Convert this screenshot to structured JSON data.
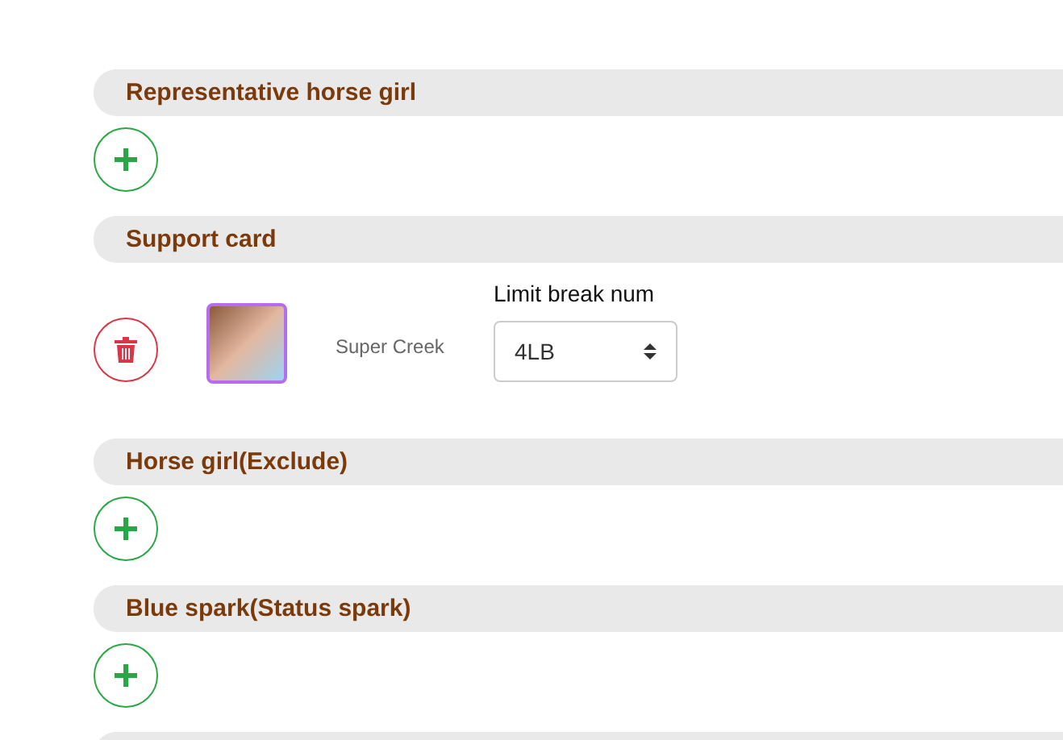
{
  "sections": [
    {
      "title": "Representative horse girl",
      "kind": "add"
    },
    {
      "title": "Support card",
      "kind": "cards",
      "cards": [
        {
          "name": "Super Creek",
          "limit_label": "Limit break num",
          "limit_value": "4LB"
        }
      ]
    },
    {
      "title": "Horse girl(Exclude)",
      "kind": "add"
    },
    {
      "title": "Blue spark(Status spark)",
      "kind": "add"
    }
  ]
}
